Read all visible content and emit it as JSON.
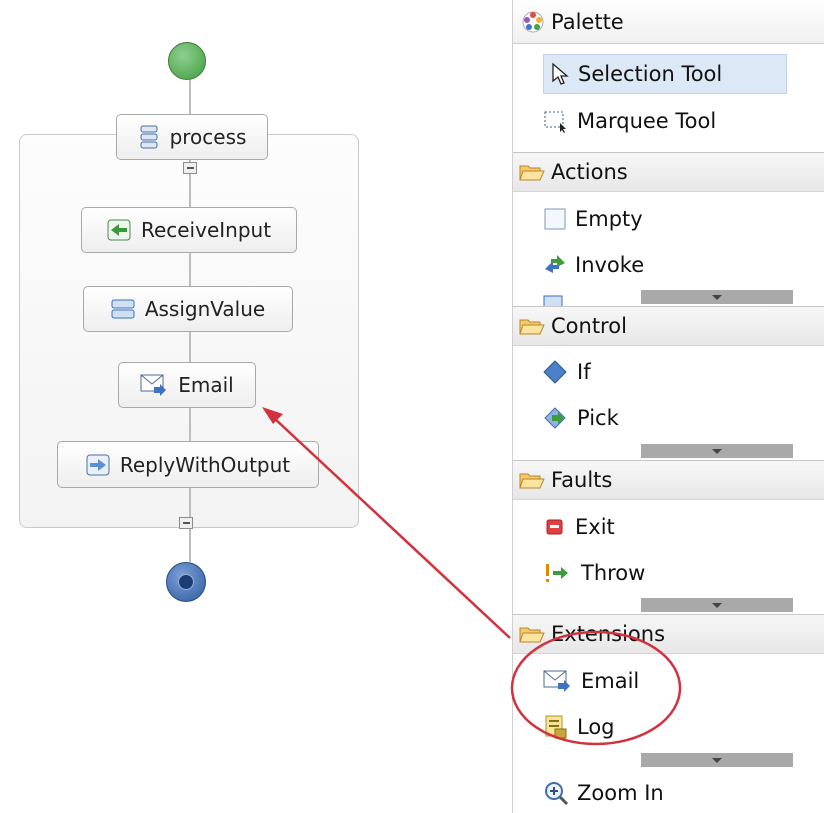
{
  "process": {
    "scope_label": "process",
    "activities": [
      {
        "label": "ReceiveInput",
        "icon": "receive-icon"
      },
      {
        "label": "AssignValue",
        "icon": "assign-icon"
      },
      {
        "label": "Email",
        "icon": "email-icon"
      },
      {
        "label": "ReplyWithOutput",
        "icon": "reply-icon"
      }
    ]
  },
  "palette": {
    "title": "Palette",
    "tools": [
      {
        "label": "Selection Tool",
        "icon": "arrow-pointer-icon",
        "selected": true
      },
      {
        "label": "Marquee Tool",
        "icon": "marquee-icon"
      }
    ],
    "drawers": [
      {
        "label": "Actions",
        "items": [
          {
            "label": "Empty",
            "icon": "empty-icon"
          },
          {
            "label": "Invoke",
            "icon": "invoke-icon"
          }
        ]
      },
      {
        "label": "Control",
        "items": [
          {
            "label": "If",
            "icon": "diamond-icon"
          },
          {
            "label": "Pick",
            "icon": "pick-icon"
          }
        ]
      },
      {
        "label": "Faults",
        "items": [
          {
            "label": "Exit",
            "icon": "exit-icon"
          },
          {
            "label": "Throw",
            "icon": "throw-icon"
          }
        ]
      },
      {
        "label": "Extensions",
        "items": [
          {
            "label": "Email",
            "icon": "email-icon"
          },
          {
            "label": "Log",
            "icon": "log-icon"
          }
        ]
      }
    ],
    "zoom_label": "Zoom In"
  },
  "colors": {
    "accent_arrow": "#d2323c",
    "selection": "#dde8f6",
    "start": "#3f9b3f",
    "end": "#2f5a9e"
  }
}
